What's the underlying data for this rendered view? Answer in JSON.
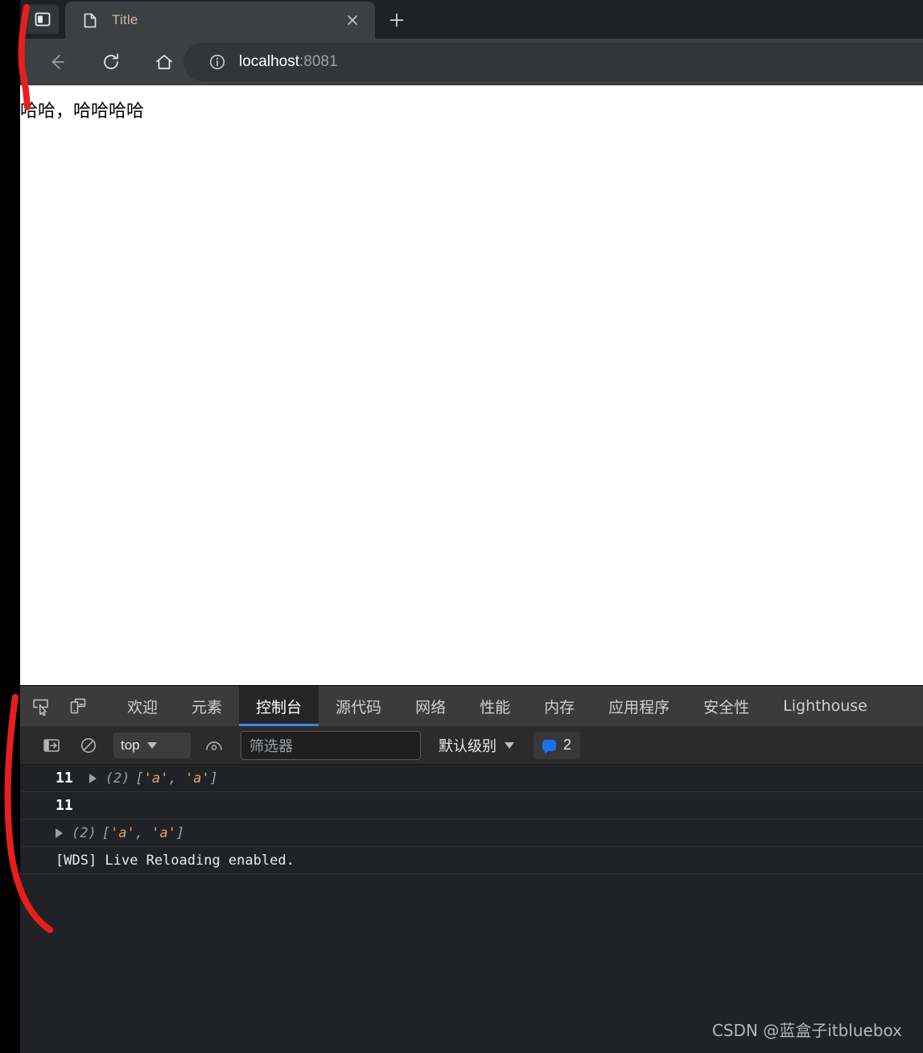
{
  "browser": {
    "tab": {
      "title": "Title",
      "favicon_icon": "page-icon",
      "close_icon": "close-icon"
    },
    "new_tab_icon": "plus-icon",
    "sidebar_toggle_icon": "sidebar-panel-icon",
    "toolbar": {
      "back_icon": "arrow-left-icon",
      "reload_icon": "reload-icon",
      "home_icon": "home-icon",
      "info_icon": "info-circle-icon",
      "url_host": "localhost",
      "url_port": ":8081"
    }
  },
  "page": {
    "body_text": "哈哈，哈哈哈哈"
  },
  "devtools": {
    "inspect_icon": "inspect-element-icon",
    "device_icon": "device-toolbar-icon",
    "tabs": [
      {
        "label": "欢迎",
        "active": false
      },
      {
        "label": "元素",
        "active": false
      },
      {
        "label": "控制台",
        "active": true
      },
      {
        "label": "源代码",
        "active": false
      },
      {
        "label": "网络",
        "active": false
      },
      {
        "label": "性能",
        "active": false
      },
      {
        "label": "内存",
        "active": false
      },
      {
        "label": "应用程序",
        "active": false
      },
      {
        "label": "安全性",
        "active": false
      },
      {
        "label": "Lighthouse",
        "active": false
      }
    ],
    "console_toolbar": {
      "sidebar_icon": "console-sidebar-icon",
      "clear_icon": "clear-console-icon",
      "context_value": "top",
      "eye_icon": "live-expression-icon",
      "filter_placeholder": "筛选器",
      "level_label": "默认级别",
      "message_count": "2",
      "message_icon": "message-bubble-icon"
    },
    "console_rows": [
      {
        "count": "11",
        "has_triangle": true,
        "array_len": "(2)",
        "array_text": "['a', 'a']",
        "plain": ""
      },
      {
        "count": "11",
        "has_triangle": false,
        "array_len": "",
        "array_text": "",
        "plain": ""
      },
      {
        "count": "",
        "has_triangle": true,
        "array_len": "(2)",
        "array_text": "['a', 'a']",
        "plain": ""
      },
      {
        "count": "",
        "has_triangle": false,
        "array_len": "",
        "array_text": "",
        "plain": "[WDS] Live Reloading enabled."
      }
    ],
    "watermark": "CSDN @蓝盒子itbluebox"
  },
  "annotation": {
    "color": "#e81e1e"
  }
}
